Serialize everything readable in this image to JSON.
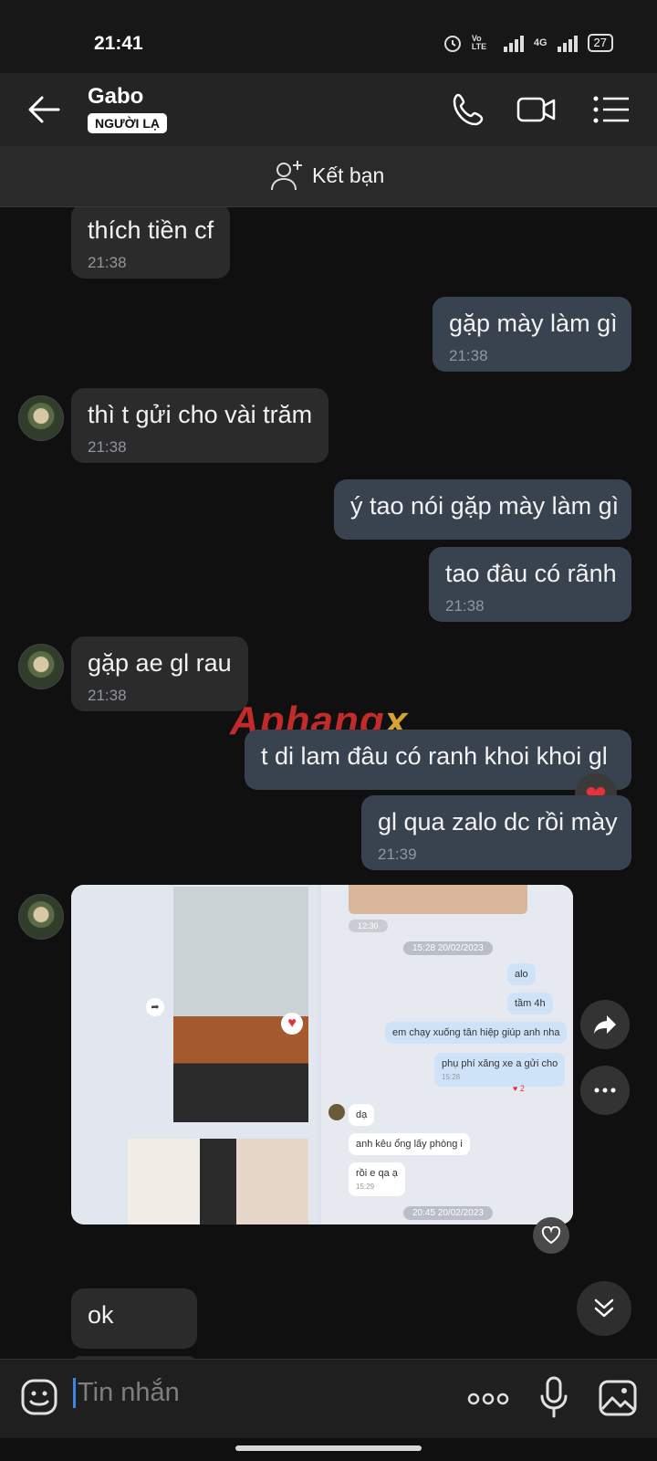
{
  "status": {
    "time": "21:41",
    "network": "4G",
    "volte": "Vo LTE",
    "battery": "27"
  },
  "header": {
    "contact_name": "Gabo",
    "badge": "NGƯỜI LẠ"
  },
  "friend_bar": {
    "label": "Kết bạn"
  },
  "messages": [
    {
      "dir": "in",
      "text": "thích tiền cf",
      "time": "21:38"
    },
    {
      "dir": "out",
      "text": "gặp mày làm gì",
      "time": "21:38"
    },
    {
      "dir": "in",
      "text": "thì t gửi cho vài trăm",
      "time": "21:38"
    },
    {
      "dir": "out",
      "text": "ý tao nói gặp mày làm gì",
      "time": ""
    },
    {
      "dir": "out",
      "text": "tao đâu có rãnh",
      "time": "21:38"
    },
    {
      "dir": "in",
      "text": "gặp ae gl rau",
      "time": "21:38"
    },
    {
      "dir": "out",
      "text": "t di lam đâu có ranh khoi khoi gl",
      "time": ""
    },
    {
      "dir": "out",
      "text": "gl qua zalo dc rồi mày",
      "time": "21:39"
    },
    {
      "dir": "in",
      "text": "ok",
      "time": ""
    }
  ],
  "watermark": {
    "part1": "Aphang",
    "part2": "x"
  },
  "photo": {
    "right": {
      "date1": "15:28 20/02/2023",
      "date2": "20:45 20/02/2023",
      "msgs": [
        "alo",
        "tầm 4h",
        "em chạy xuống tân hiệp giúp anh nha",
        "phụ phí xăng xe a gửi cho",
        "dạ",
        "anh kêu ổng lấy phòng i",
        "rồi e qa ạ"
      ],
      "times": [
        "12:30",
        "15:28",
        "15:29"
      ],
      "heart_count": "2"
    }
  },
  "input": {
    "placeholder": "Tin nhắn"
  },
  "colors": {
    "accent": "#3a86e0",
    "heart": "#e5323b"
  }
}
